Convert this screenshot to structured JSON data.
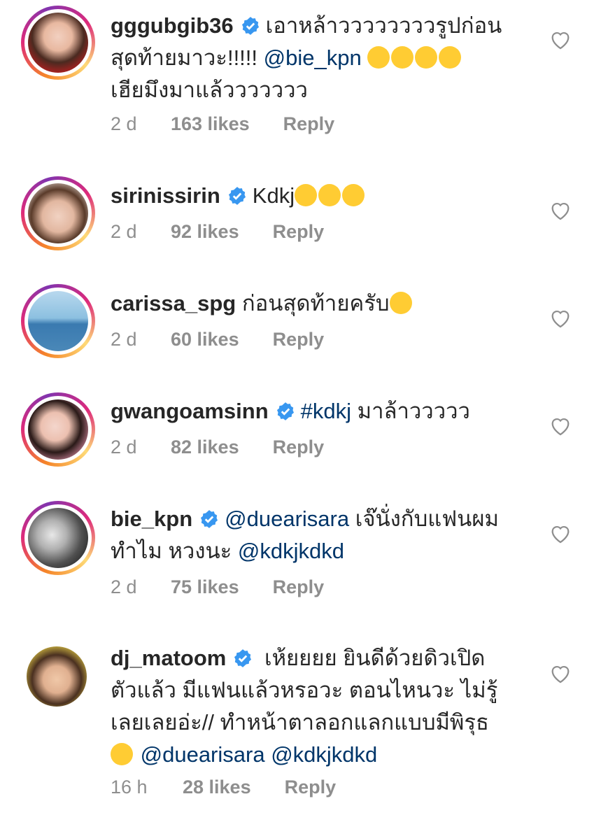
{
  "comments": [
    {
      "username": "gggubgib36",
      "text_lines": [
        "เอาหล้าววววววววรูปก่อน",
        "สุดท้ายมาวะ!!!!! "
      ],
      "mention_inline": "@bie_kpn",
      "line3": "เฮียมึงมาแล้ววววววว",
      "time": "2 d",
      "likes": "163 likes",
      "reply": "Reply"
    },
    {
      "username": "sirinissirin",
      "text": "Kdkj",
      "time": "2 d",
      "likes": "92 likes",
      "reply": "Reply"
    },
    {
      "username": "carissa_spg",
      "text": "ก่อนสุดท้ายครับ",
      "time": "2 d",
      "likes": "60 likes",
      "reply": "Reply"
    },
    {
      "username": "gwangoamsinn",
      "hashtag": "#kdkj",
      "text": " มาล้าววววว",
      "time": "2 d",
      "likes": "82 likes",
      "reply": "Reply"
    },
    {
      "username": "bie_kpn",
      "mention1": "@duearisara",
      "text1": " เจ๊นั่งกับแฟนผม",
      "text2": "ทำไม หวงนะ ",
      "mention2": "@kdkjkdkd",
      "time": "2 d",
      "likes": "75 likes",
      "reply": "Reply"
    },
    {
      "username": "dj_matoom",
      "text1": " เห้ยยยย ยินดีด้วยดิวเปิด",
      "text2": "ตัวแล้ว มีแฟนแล้วหรอวะ ตอนไหนวะ ไม่รู้",
      "text3": "เลยเลยอ่ะ// ทำหน้าตาลอกแลกแบบมีพิรุธ",
      "mention1": "@duearisara",
      "mention2": "@kdkjkdkd",
      "time": "16 h",
      "likes": "28 likes",
      "reply": "Reply"
    }
  ],
  "colors": {
    "verified": "#3897f0",
    "mention": "#003569",
    "meta": "#8e8e8e",
    "text": "#262626"
  }
}
